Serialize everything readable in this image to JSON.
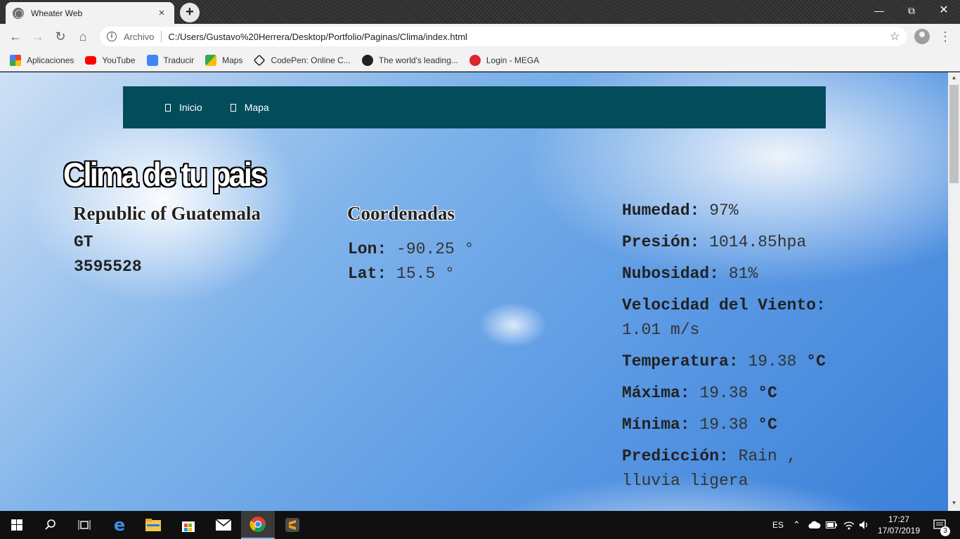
{
  "browser": {
    "tab_title": "Wheater Web",
    "tab_close": "×",
    "new_tab": "+",
    "scheme_label": "Archivo",
    "url": "C:/Users/Gustavo%20Herrera/Desktop/Portfolio/Paginas/Clima/index.html",
    "bookmarks": [
      "Aplicaciones",
      "YouTube",
      "Traducir",
      "Maps",
      "CodePen: Online C...",
      "The world's leading...",
      "Login - MEGA"
    ]
  },
  "site": {
    "nav": [
      "Inicio",
      "Mapa"
    ],
    "title": "Clima de tu pais",
    "country": {
      "name": "Republic of Guatemala",
      "code": "GT",
      "id": "3595528"
    },
    "coordinates": {
      "heading": "Coordenadas",
      "lon_label": "Lon:",
      "lon_value": "-90.25 °",
      "lat_label": "Lat:",
      "lat_value": "15.5 °"
    },
    "weather": [
      {
        "label": "Humedad:",
        "value": "97%",
        "unit": ""
      },
      {
        "label": "Presión:",
        "value": "1014.85hpa",
        "unit": ""
      },
      {
        "label": "Nubosidad:",
        "value": "81%",
        "unit": ""
      },
      {
        "label": "Velocidad del Viento:",
        "value": "1.01 m/s",
        "unit": ""
      },
      {
        "label": "Temperatura:",
        "value": "19.38",
        "unit": "°C"
      },
      {
        "label": "Máxima:",
        "value": "19.38",
        "unit": "°C"
      },
      {
        "label": "Mínima:",
        "value": "19.38",
        "unit": "°C"
      },
      {
        "label": "Predicción:",
        "value": "Rain , lluvia ligera",
        "unit": ""
      }
    ]
  },
  "taskbar": {
    "language": "ES",
    "time": "17:27",
    "date": "17/07/2019",
    "notifications": "3"
  },
  "colors": {
    "nav_bg": "#034c5b",
    "youtube": "#ff0000",
    "mega": "#d9272e",
    "sublime": "#f59c1a"
  }
}
